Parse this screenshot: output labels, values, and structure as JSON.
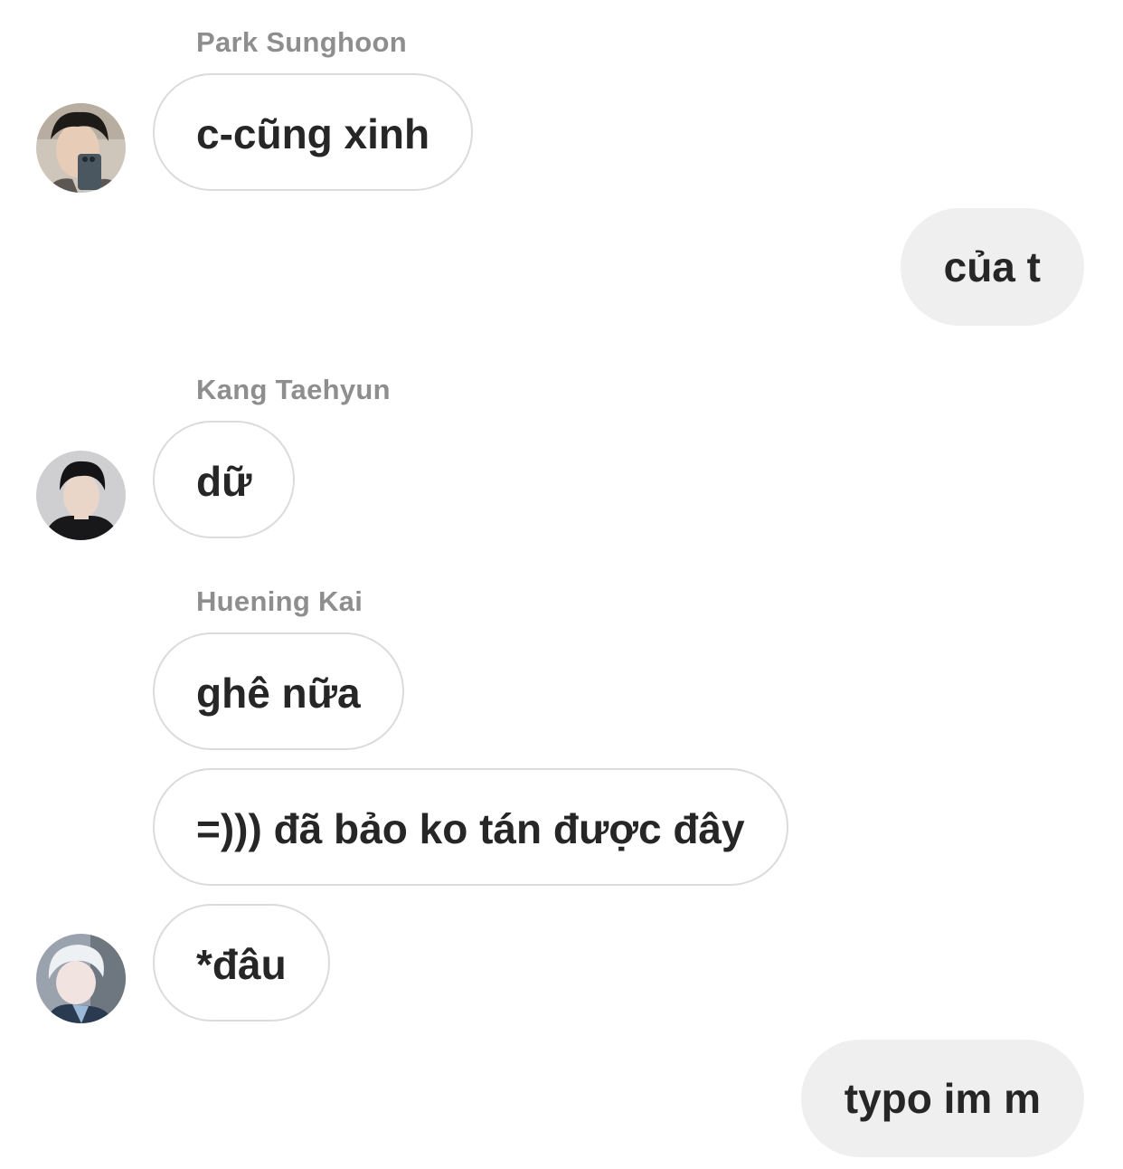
{
  "thread": {
    "groups": [
      {
        "sender": "Park Sunghoon",
        "messages": [
          "c-cũng xinh"
        ]
      },
      {
        "sender": "",
        "messages": [
          "của t"
        ]
      },
      {
        "sender": "Kang Taehyun",
        "messages": [
          "dữ"
        ]
      },
      {
        "sender": "Huening Kai",
        "messages": [
          "ghê nữa",
          "=))) đã bảo ko tán được đây",
          "*đâu"
        ]
      },
      {
        "sender": "",
        "messages": [
          "typo im m"
        ]
      }
    ]
  }
}
